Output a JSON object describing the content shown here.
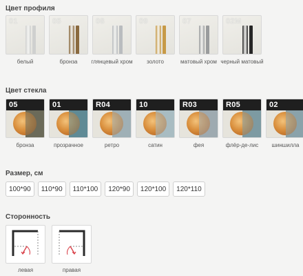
{
  "profile": {
    "title": "Цвет профиля",
    "items": [
      {
        "code": "01",
        "label": "белый",
        "bar_color": "#cfd0cf"
      },
      {
        "code": "05",
        "label": "бронза",
        "bar_color": "#8a6a3f"
      },
      {
        "code": "08",
        "label": "глянцевый хром",
        "bar_color": "#b9bcbf"
      },
      {
        "code": "09",
        "label": "золото",
        "bar_color": "#c79a47"
      },
      {
        "code": "07",
        "label": "матовый хром",
        "bar_color": "#9a9c9d"
      },
      {
        "code": "02M",
        "label": "черный матовый",
        "bar_color": "#262626"
      }
    ]
  },
  "glass": {
    "title": "Цвет стекла",
    "items": [
      {
        "code": "05",
        "label": "бронза",
        "tint": "#6b6a5a"
      },
      {
        "code": "01",
        "label": "прозрачное",
        "tint": "#5f8a95"
      },
      {
        "code": "R04",
        "label": "ретро",
        "tint": "#9fb0b6"
      },
      {
        "code": "10",
        "label": "сатин",
        "tint": "#a8bcc2"
      },
      {
        "code": "R03",
        "label": "фея",
        "tint": "#9eaab0"
      },
      {
        "code": "R05",
        "label": "флёр-де-лис",
        "tint": "#7d9aa3"
      },
      {
        "code": "02",
        "label": "шиншилла",
        "tint": "#8aa3aa"
      }
    ]
  },
  "size": {
    "title": "Размер, см",
    "options": [
      "100*90",
      "110*90",
      "110*100",
      "120*90",
      "120*100",
      "120*110"
    ]
  },
  "side": {
    "title": "Сторонность",
    "options": [
      {
        "label": "левая"
      },
      {
        "label": "правая"
      }
    ]
  },
  "colors": {
    "background": "#f4f4f3",
    "arrow": "#d9434b"
  }
}
